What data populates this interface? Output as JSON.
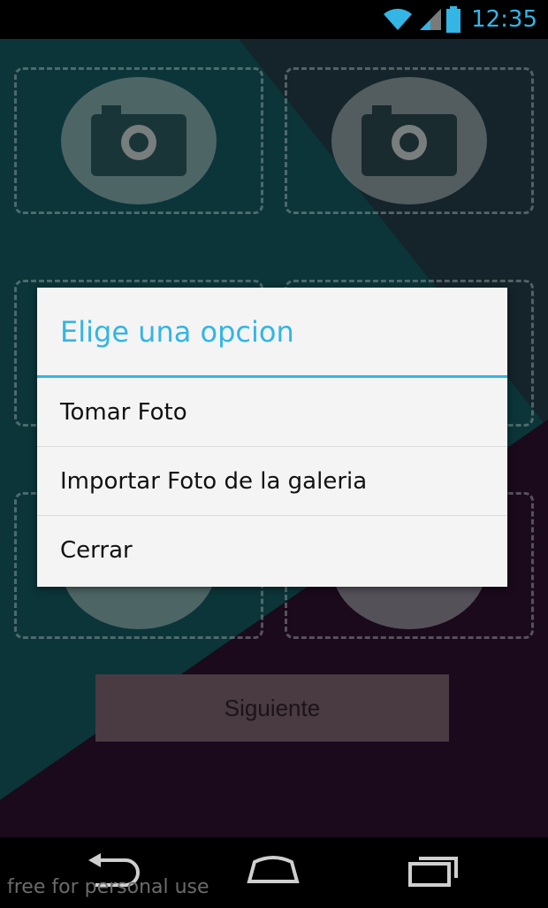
{
  "status_bar": {
    "time": "12:35",
    "icons": [
      "wifi-icon",
      "signal-icon",
      "battery-icon"
    ],
    "accent": "#33b5e5"
  },
  "screen": {
    "next_button_label": "Siguiente",
    "photo_slots": [
      "camera-icon",
      "camera-icon",
      "camera-icon",
      "camera-icon",
      "camera-icon",
      "camera-icon"
    ]
  },
  "dialog": {
    "title": "Elige una opcion",
    "items": [
      {
        "label": "Tomar Foto"
      },
      {
        "label": "Importar Foto de la galeria"
      },
      {
        "label": "Cerrar"
      }
    ]
  },
  "nav_bar": {
    "buttons": [
      "back-icon",
      "home-icon",
      "recents-icon"
    ]
  },
  "watermark": "free for personal use"
}
